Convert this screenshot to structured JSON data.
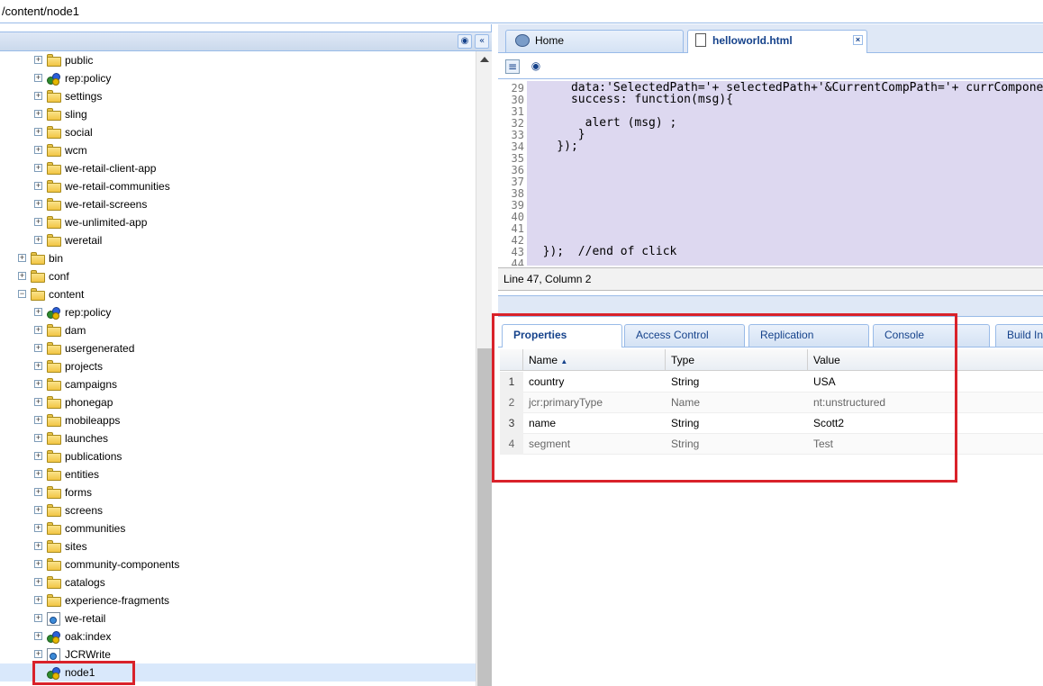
{
  "path_bar": {
    "text": "/content/node1"
  },
  "tree": {
    "items": [
      {
        "label": "public",
        "indent": 2,
        "icon": "folder"
      },
      {
        "label": "rep:policy",
        "indent": 2,
        "icon": "node"
      },
      {
        "label": "settings",
        "indent": 2,
        "icon": "folder"
      },
      {
        "label": "sling",
        "indent": 2,
        "icon": "folder"
      },
      {
        "label": "social",
        "indent": 2,
        "icon": "folder"
      },
      {
        "label": "wcm",
        "indent": 2,
        "icon": "folder"
      },
      {
        "label": "we-retail-client-app",
        "indent": 2,
        "icon": "folder"
      },
      {
        "label": "we-retail-communities",
        "indent": 2,
        "icon": "folder"
      },
      {
        "label": "we-retail-screens",
        "indent": 2,
        "icon": "folder"
      },
      {
        "label": "we-unlimited-app",
        "indent": 2,
        "icon": "folder"
      },
      {
        "label": "weretail",
        "indent": 2,
        "icon": "folder"
      },
      {
        "label": "bin",
        "indent": 1,
        "icon": "folder"
      },
      {
        "label": "conf",
        "indent": 1,
        "icon": "folder"
      },
      {
        "label": "content",
        "indent": 1,
        "icon": "folder",
        "expanded": true
      },
      {
        "label": "rep:policy",
        "indent": 2,
        "icon": "node"
      },
      {
        "label": "dam",
        "indent": 2,
        "icon": "folder"
      },
      {
        "label": "usergenerated",
        "indent": 2,
        "icon": "folder"
      },
      {
        "label": "projects",
        "indent": 2,
        "icon": "folder"
      },
      {
        "label": "campaigns",
        "indent": 2,
        "icon": "folder"
      },
      {
        "label": "phonegap",
        "indent": 2,
        "icon": "folder"
      },
      {
        "label": "mobileapps",
        "indent": 2,
        "icon": "folder"
      },
      {
        "label": "launches",
        "indent": 2,
        "icon": "folder"
      },
      {
        "label": "publications",
        "indent": 2,
        "icon": "folder"
      },
      {
        "label": "entities",
        "indent": 2,
        "icon": "folder"
      },
      {
        "label": "forms",
        "indent": 2,
        "icon": "folder"
      },
      {
        "label": "screens",
        "indent": 2,
        "icon": "folder"
      },
      {
        "label": "communities",
        "indent": 2,
        "icon": "folder"
      },
      {
        "label": "sites",
        "indent": 2,
        "icon": "folder"
      },
      {
        "label": "community-components",
        "indent": 2,
        "icon": "folder"
      },
      {
        "label": "catalogs",
        "indent": 2,
        "icon": "folder"
      },
      {
        "label": "experience-fragments",
        "indent": 2,
        "icon": "folder"
      },
      {
        "label": "we-retail",
        "indent": 2,
        "icon": "file"
      },
      {
        "label": "oak:index",
        "indent": 2,
        "icon": "node"
      },
      {
        "label": "JCRWrite",
        "indent": 2,
        "icon": "file"
      },
      {
        "label": "node1",
        "indent": 2,
        "icon": "node",
        "selected": true,
        "leaf": true
      }
    ]
  },
  "editor_tabs": [
    {
      "label": "Home",
      "icon": "home-icon"
    },
    {
      "label": "helloworld.html",
      "icon": "document-icon",
      "active": true
    }
  ],
  "editor": {
    "lines": [
      {
        "n": "29",
        "code": "      data:'SelectedPath='+ selectedPath+'&CurrentCompPath='+ currComponent"
      },
      {
        "n": "30",
        "code": "      success: function(msg){"
      },
      {
        "n": "31",
        "code": ""
      },
      {
        "n": "32",
        "code": "        alert (msg) ;"
      },
      {
        "n": "33",
        "code": "       }"
      },
      {
        "n": "34",
        "code": "    });"
      },
      {
        "n": "35",
        "code": ""
      },
      {
        "n": "36",
        "code": ""
      },
      {
        "n": "37",
        "code": ""
      },
      {
        "n": "38",
        "code": ""
      },
      {
        "n": "39",
        "code": ""
      },
      {
        "n": "40",
        "code": ""
      },
      {
        "n": "41",
        "code": ""
      },
      {
        "n": "42",
        "code": ""
      },
      {
        "n": "43",
        "code": "  });  //end of click"
      },
      {
        "n": "44",
        "code": ""
      }
    ],
    "status": "Line 47, Column 2"
  },
  "property_tabs": [
    "Properties",
    "Access Control",
    "Replication",
    "Console",
    "Build In"
  ],
  "grid": {
    "columns": [
      "Name",
      "Type",
      "Value"
    ],
    "rows": [
      {
        "num": "1",
        "name": "country",
        "type": "String",
        "value": "USA"
      },
      {
        "num": "2",
        "name": "jcr:primaryType",
        "type": "Name",
        "value": "nt:unstructured"
      },
      {
        "num": "3",
        "name": "name",
        "type": "String",
        "value": "Scott2"
      },
      {
        "num": "4",
        "name": "segment",
        "type": "String",
        "value": "Test"
      }
    ]
  },
  "colors": {
    "highlight": "#d9222a",
    "accent": "#15428b",
    "editor_bg": "#ddd8f0"
  }
}
